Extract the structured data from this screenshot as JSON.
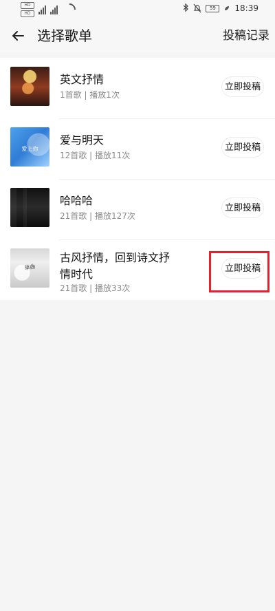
{
  "status_bar": {
    "badges": [
      "HD",
      "HD"
    ],
    "network": [
      "4G",
      "4G"
    ],
    "battery": "59",
    "time": "18:39"
  },
  "header": {
    "back_icon": "back-arrow-icon",
    "title": "选择歌单",
    "action_label": "投稿记录"
  },
  "playlists": [
    {
      "title": "英文抒情",
      "meta": "1首歌 | 播放1次",
      "button": "立即投稿",
      "cover_icon": "album-cover-1"
    },
    {
      "title": "爱与明天",
      "meta": "12首歌 | 播放11次",
      "button": "立即投稿",
      "cover_text": "爱上你",
      "cover_icon": "album-cover-2"
    },
    {
      "title": "哈哈哈",
      "meta": "21首歌 | 播放127次",
      "button": "立即投稿",
      "cover_icon": "album-cover-3"
    },
    {
      "title": "古风抒情，回到诗文抒情时代",
      "meta": "21首歌 | 播放33次",
      "button": "立即投稿",
      "cover_text": "单曲",
      "cover_icon": "album-cover-4"
    }
  ],
  "colors": {
    "background": "#f5f5f5",
    "header_bg": "#f7f7f7",
    "highlight": "#e3222b",
    "text": "#111111",
    "meta": "#8a8a8a"
  }
}
